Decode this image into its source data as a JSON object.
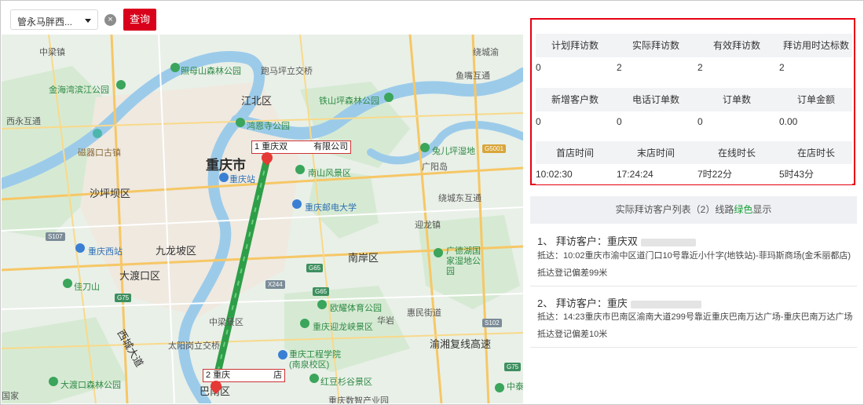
{
  "toolbar": {
    "select_value": "管永马胖西...",
    "query_label": "查询",
    "clear_glyph": "×"
  },
  "map": {
    "labels": [
      {
        "id": "xiliangzhen",
        "text": "中梁镇"
      },
      {
        "id": "jinhaiwan",
        "text": "金海湾滨江公园"
      },
      {
        "id": "zhaomushan",
        "text": "照母山森林公园"
      },
      {
        "id": "paomapiing",
        "text": "跑马坪立交桥"
      },
      {
        "id": "jiangbei",
        "text": "江北区"
      },
      {
        "id": "tieshan",
        "text": "铁山坪森林公园"
      },
      {
        "id": "yuzui",
        "text": "鱼嘴互通"
      },
      {
        "id": "raocheng",
        "text": "绕城渝"
      },
      {
        "id": "xiyong",
        "text": "西永互通"
      },
      {
        "id": "hongen",
        "text": "鸿恩寺公园"
      },
      {
        "id": "ciqikou",
        "text": "磁器口古镇"
      },
      {
        "id": "chongqing",
        "text": "重庆市"
      },
      {
        "id": "chongqingzhan",
        "text": "重庆站"
      },
      {
        "id": "nanshan",
        "text": "南山风景区"
      },
      {
        "id": "guangyang",
        "text": "广阳岛"
      },
      {
        "id": "tuerping",
        "text": "兔儿坪湿地"
      },
      {
        "id": "shapingba",
        "text": "沙坪坝区"
      },
      {
        "id": "youdian",
        "text": "重庆邮电大学"
      },
      {
        "id": "raochengdong",
        "text": "绕城东互通"
      },
      {
        "id": "chongqingxi",
        "text": "重庆西站"
      },
      {
        "id": "jiulongpo",
        "text": "九龙坡区"
      },
      {
        "id": "nanan",
        "text": "南岸区"
      },
      {
        "id": "yinglong",
        "text": "迎龙镇"
      },
      {
        "id": "guangdaohu",
        "text": "广德湖国家湿地公园"
      },
      {
        "id": "dadukou",
        "text": "大渡口区"
      },
      {
        "id": "jiadaoshan",
        "text": "佳刀山"
      },
      {
        "id": "ouhui",
        "text": "欧耀体育公园"
      },
      {
        "id": "huiminjie",
        "text": "惠民街道"
      },
      {
        "id": "huaxi",
        "text": "华岩"
      },
      {
        "id": "chongqingyinglong",
        "text": "重庆迎龙峡景区"
      },
      {
        "id": "yuxiang",
        "text": "渝湘复线高速"
      },
      {
        "id": "xicheng",
        "text": "西城大道"
      },
      {
        "id": "taiyanggang",
        "text": "太阳岗立交桥"
      },
      {
        "id": "zhongjing",
        "text": "中梁景区"
      },
      {
        "id": "gongcheng",
        "text": "重庆工程学院(南泉校区)"
      },
      {
        "id": "dadukou_forest",
        "text": "大渡口森林公园"
      },
      {
        "id": "hongdou",
        "text": "红豆杉谷景区"
      },
      {
        "id": "banan",
        "text": "巴南区"
      },
      {
        "id": "shuyi",
        "text": "重庆数智产业园"
      },
      {
        "id": "chongqing_zhongzhong",
        "text": "中泰"
      },
      {
        "id": "guojia",
        "text": "国家"
      }
    ],
    "roads": [
      "S107",
      "G5001",
      "G75",
      "X244",
      "G65",
      "S102",
      "G65",
      "G75"
    ],
    "markers": [
      {
        "label": "1 重庆双　　　有限公司"
      },
      {
        "label": "2 重庆　　　　　店"
      }
    ]
  },
  "stats": {
    "groups": [
      {
        "headers": [
          "计划拜访数",
          "实际拜访数",
          "有效拜访数",
          "拜访用时达标数"
        ],
        "values": [
          "0",
          "2",
          "2",
          "2"
        ]
      },
      {
        "headers": [
          "新增客户数",
          "电话订单数",
          "订单数",
          "订单金额"
        ],
        "values": [
          "0",
          "0",
          "0",
          "0.00"
        ]
      },
      {
        "headers": [
          "首店时间",
          "末店时间",
          "在线时长",
          "在店时长"
        ],
        "values": [
          "10:02:30",
          "17:24:24",
          "7时22分",
          "5时43分"
        ]
      }
    ]
  },
  "list": {
    "title_prefix": "实际拜访客户列表（2）线路",
    "title_green": "绿色",
    "title_suffix": "显示",
    "items": [
      {
        "title": "1、 拜访客户：重庆双",
        "arrive": "抵达：10:02重庆市渝中区道门口10号靠近小什字(地铁站)-菲玛斯商场(金禾丽都店)",
        "deviation": "抵达登记偏差99米"
      },
      {
        "title": "2、 拜访客户：重庆",
        "arrive": "抵达：14:23重庆市巴南区渝南大道299号靠近重庆巴南万达广场-重庆巴南万达广场",
        "deviation": "抵达登记偏差10米"
      }
    ]
  },
  "colors": {
    "accent_red": "#d9001b",
    "route_green": "#2e9e48",
    "panel_border": "#e60012"
  }
}
